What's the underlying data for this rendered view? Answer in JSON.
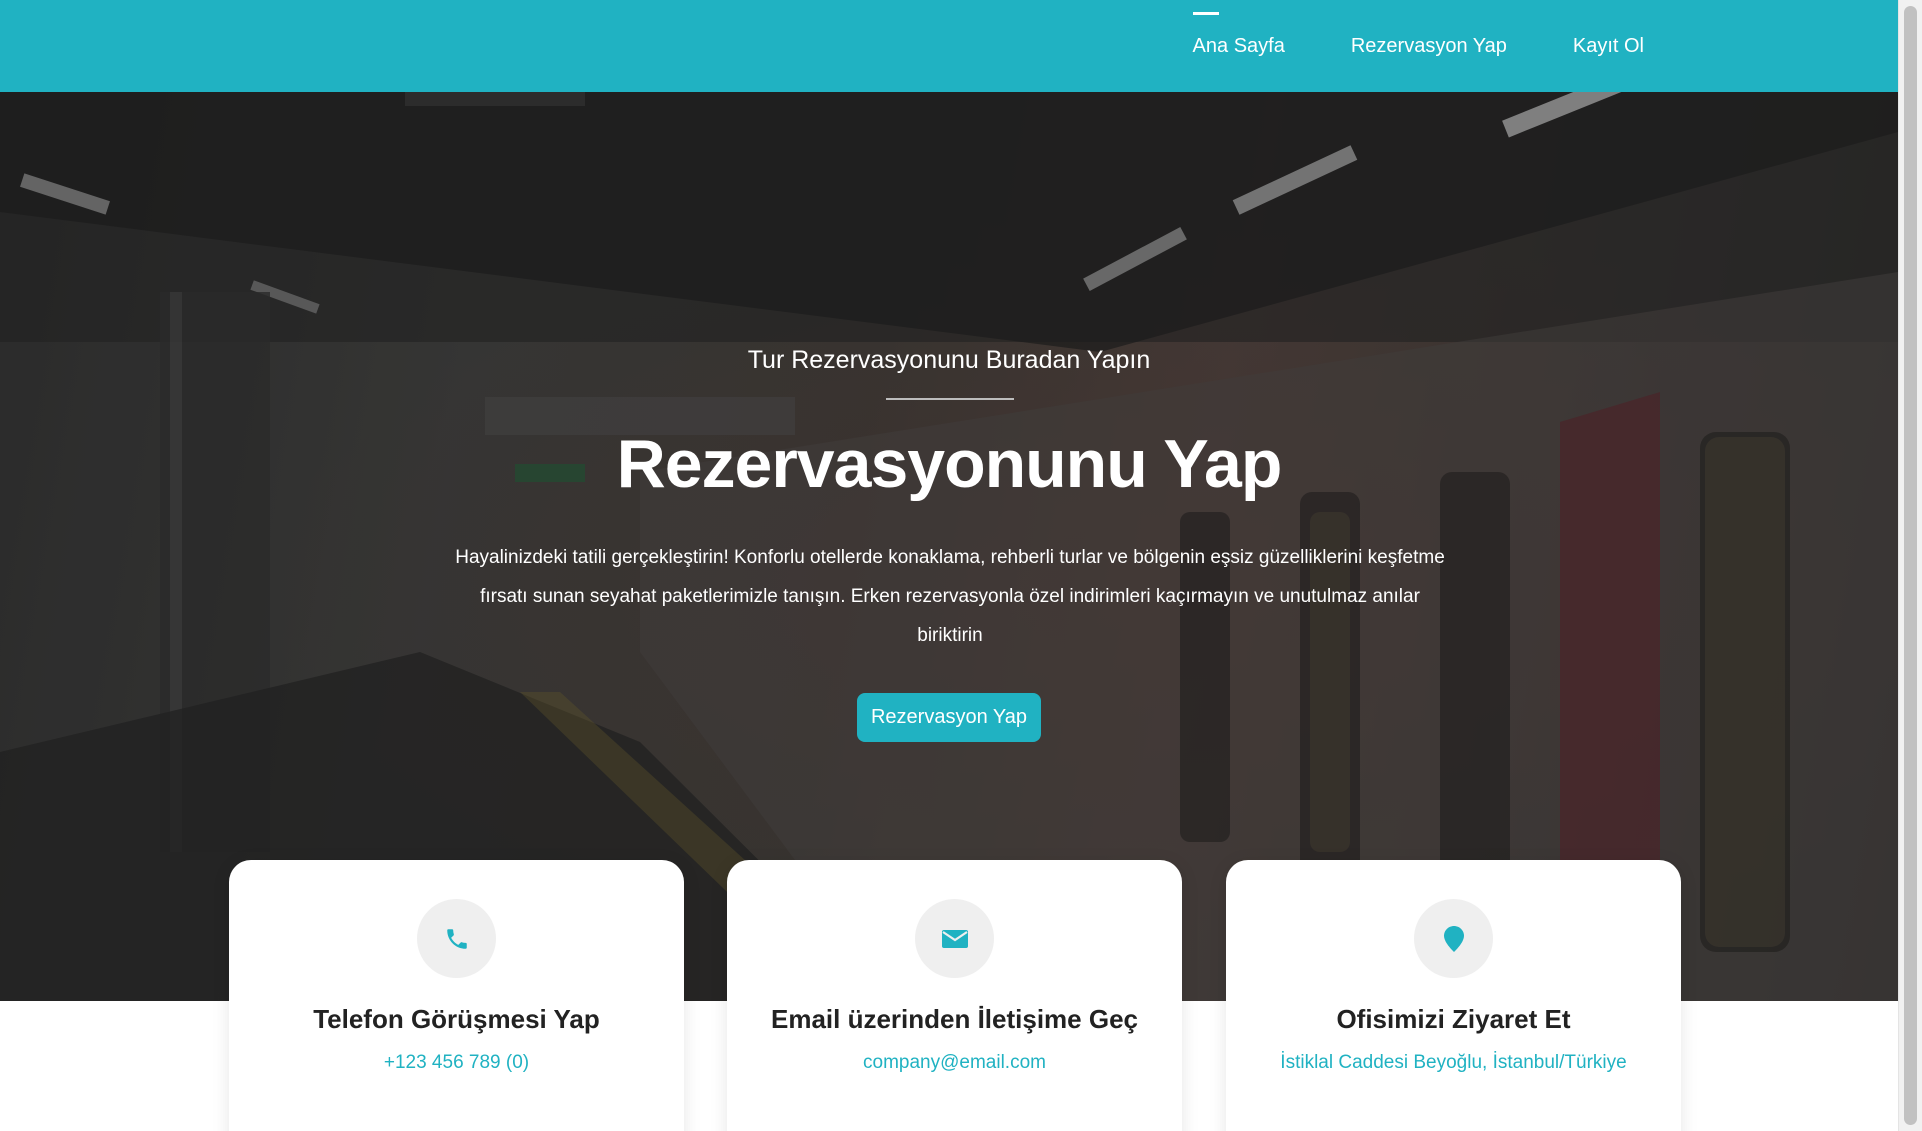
{
  "nav": {
    "items": [
      {
        "label": "Ana Sayfa",
        "active": true
      },
      {
        "label": "Rezervasyon Yap",
        "active": false
      },
      {
        "label": "Kayıt Ol",
        "active": false
      }
    ]
  },
  "hero": {
    "subtitle": "Tur Rezervasyonunu Buradan Yapın",
    "title": "Rezervasyonunu Yap",
    "text": "Hayalinizdeki tatili gerçekleştirin! Konforlu otellerde konaklama, rehberli turlar ve bölgenin eşsiz güzelliklerini keşfetme fırsatı sunan seyahat paketlerimizle tanışın. Erken rezervasyonla özel indirimleri kaçırmayın ve unutulmaz anılar biriktirin",
    "button_label": "Rezervasyon Yap"
  },
  "cards": [
    {
      "icon": "phone-icon",
      "title": "Telefon Görüşmesi Yap",
      "info": "+123 456 789 (0)"
    },
    {
      "icon": "envelope-icon",
      "title": "Email üzerinden İletişime Geç",
      "info": "company@email.com"
    },
    {
      "icon": "map-marker-icon",
      "title": "Ofisimizi Ziyaret Et",
      "info": "İstiklal Caddesi Beyoğlu, İstanbul/Türkiye"
    }
  ],
  "colors": {
    "accent": "#20b2c2",
    "text_dark": "#222222",
    "icon_bg": "#efefef"
  }
}
